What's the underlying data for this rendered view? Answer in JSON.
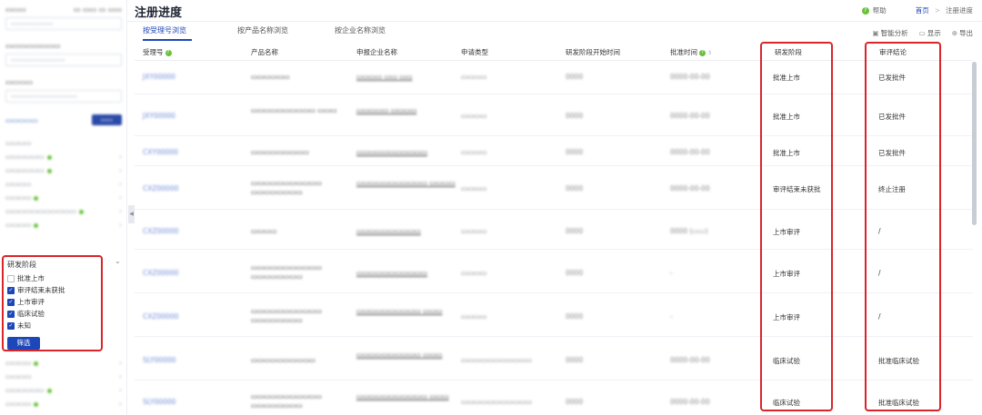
{
  "page": {
    "title": "注册进度"
  },
  "top_right": {
    "help_label": "帮助",
    "breadcrumb": [
      "首页",
      "注册进度"
    ]
  },
  "tabs": [
    {
      "label": "按受理号浏览",
      "active": true
    },
    {
      "label": "按产品名称浏览",
      "active": false
    },
    {
      "label": "按企业名称浏览",
      "active": false
    }
  ],
  "toolbar": {
    "analysis": "智能分析",
    "display": "显示",
    "export": "导出"
  },
  "table": {
    "headers": {
      "accept_no": "受理号",
      "product": "产品名称",
      "enterprise": "申报企业名称",
      "apply_type": "申请类型",
      "stage_start": "研发阶段开始时间",
      "approve_time": "批准时间",
      "stage": "研发阶段",
      "conclusion": "审评结论"
    },
    "rows": [
      {
        "stage": "批准上市",
        "conclusion": "已发批件"
      },
      {
        "stage": "批准上市",
        "conclusion": "已发批件"
      },
      {
        "stage": "批准上市",
        "conclusion": "已发批件"
      },
      {
        "stage": "审评结束未获批",
        "conclusion": "终止注册"
      },
      {
        "stage": "上市审评",
        "conclusion": "/"
      },
      {
        "stage": "上市审评",
        "conclusion": "/"
      },
      {
        "stage": "上市审评",
        "conclusion": "/"
      },
      {
        "stage": "临床试验",
        "conclusion": "批准临床试验"
      },
      {
        "stage": "临床试验",
        "conclusion": "批准临床试验"
      }
    ]
  },
  "sidebar": {
    "filter_section": {
      "title": "研发阶段",
      "options": [
        {
          "label": "批准上市",
          "checked": false
        },
        {
          "label": "审评结束未获批",
          "checked": true
        },
        {
          "label": "上市审评",
          "checked": true
        },
        {
          "label": "临床试验",
          "checked": true
        },
        {
          "label": "未知",
          "checked": true
        }
      ],
      "button_label": "筛选"
    }
  },
  "colors": {
    "accent": "#1d46b8",
    "highlight": "#d9252a",
    "help": "#67c23a"
  }
}
